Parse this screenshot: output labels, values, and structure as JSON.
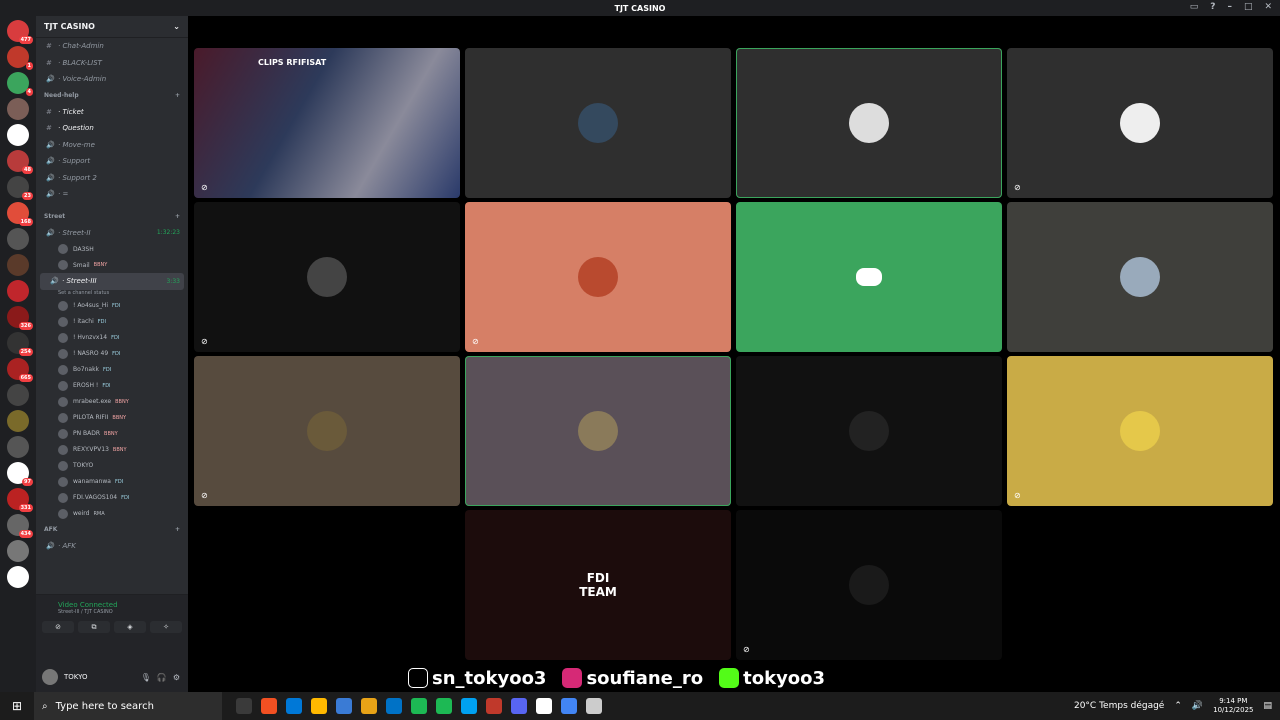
{
  "window": {
    "title": "TJT CASINO"
  },
  "guilds": [
    {
      "color": "#d83c3e",
      "badge": "477"
    },
    {
      "color": "#c0392b",
      "badge": "1"
    },
    {
      "color": "#3ba55d",
      "badge": "4"
    },
    {
      "color": "#7b5e57",
      "badge": ""
    },
    {
      "color": "#ffffff",
      "badge": ""
    },
    {
      "color": "#b83b3b",
      "badge": "48"
    },
    {
      "color": "#444",
      "badge": "23"
    },
    {
      "color": "#e14d3a",
      "badge": "168"
    },
    {
      "color": "#555",
      "badge": ""
    },
    {
      "color": "#5a3a2a",
      "badge": ""
    },
    {
      "color": "#c0262c",
      "badge": ""
    },
    {
      "color": "#8a1a1a",
      "badge": "326"
    },
    {
      "color": "#333",
      "badge": "254"
    },
    {
      "color": "#a22",
      "badge": "665"
    },
    {
      "color": "#444",
      "badge": ""
    },
    {
      "color": "#7a6a2a",
      "badge": ""
    },
    {
      "color": "#555",
      "badge": ""
    },
    {
      "color": "#fff",
      "badge": "97"
    },
    {
      "color": "#b22",
      "badge": "331"
    },
    {
      "color": "#666",
      "badge": "434"
    },
    {
      "color": "#777",
      "badge": ""
    },
    {
      "color": "#ffffff",
      "badge": ""
    }
  ],
  "sidebar": {
    "server_name": "TJT CASINO",
    "channels_top": [
      {
        "icon": "#",
        "label": "· Chat-Admin"
      },
      {
        "icon": "#",
        "label": "· BLACK-LIST"
      },
      {
        "icon": "🔊",
        "label": "· Voice-Admin"
      }
    ],
    "cat_help": "Need-help",
    "channels_help": [
      {
        "icon": "#",
        "label": "· Ticket",
        "active": true
      },
      {
        "icon": "#",
        "label": "· Question",
        "active": true
      },
      {
        "icon": "🔊",
        "label": "· Move-me"
      },
      {
        "icon": "🔊",
        "label": "· Support"
      },
      {
        "icon": "🔊",
        "label": "· Support 2"
      },
      {
        "icon": "🔊",
        "label": "· ="
      }
    ],
    "cat_street": "Street",
    "street2": {
      "label": "· Street-II",
      "time": "1:32:23"
    },
    "street2_users": [
      {
        "name": "DA3SH",
        "tag": ""
      },
      {
        "name": "Smail",
        "tag": "BBNY"
      }
    ],
    "street3": {
      "label": "· Street-III",
      "time": "3:33",
      "status": "Set a channel status"
    },
    "street3_users": [
      {
        "name": "! Ao4sus_Hi",
        "tag": "FDI"
      },
      {
        "name": "! itachi",
        "tag": "FDI"
      },
      {
        "name": "! Hvnzvx14",
        "tag": "FDI"
      },
      {
        "name": "! NASRO 49",
        "tag": "FDI"
      },
      {
        "name": "Bo7nakk",
        "tag": "FDI"
      },
      {
        "name": "EROSH !",
        "tag": "FDI"
      },
      {
        "name": "mrabeet.exe",
        "tag": "BBNY"
      },
      {
        "name": "PILOTA RIFII",
        "tag": "BBNY"
      },
      {
        "name": "PN BADR",
        "tag": "BBNY"
      },
      {
        "name": "REXY.VPV13",
        "tag": "BBNY"
      },
      {
        "name": "TOKYO",
        "tag": ""
      },
      {
        "name": "wanamanwa",
        "tag": "FDI"
      },
      {
        "name": "FDI.VAGOS104",
        "tag": "FDI"
      },
      {
        "name": "weird",
        "tag": "RMA"
      }
    ],
    "cat_afk": "AFK",
    "afk_channel": "· AFK"
  },
  "voice_panel": {
    "title": "Video Connected",
    "subtitle": "Street-III / TJT CASINO"
  },
  "user_panel": {
    "name": "TOKYO"
  },
  "stage": {
    "stream_label": "CLIPS RFIFISAT",
    "tiles": [
      {
        "bg": "#2a2a30",
        "avatar": "#5b6b8c",
        "mute": true,
        "stream": true
      },
      {
        "bg": "#2f2f2f",
        "avatar": "#34495e",
        "mute": false
      },
      {
        "bg": "#2f2f2f",
        "avatar": "#ddd",
        "mute": false,
        "speaking": true
      },
      {
        "bg": "#2f2f2f",
        "avatar": "#eee",
        "mute": true
      },
      {
        "bg": "#111111",
        "avatar": "#444",
        "mute": true
      },
      {
        "bg": "#d67f66",
        "avatar": "#b94a2f",
        "mute": true
      },
      {
        "bg": "#3ba55d",
        "avatar": "",
        "mute": false,
        "discord": true
      },
      {
        "bg": "#3f3f3b",
        "avatar": "#9ab",
        "mute": false
      },
      {
        "bg": "#574b3e",
        "avatar": "#6a5a3a",
        "mute": true
      },
      {
        "bg": "#5a5058",
        "avatar": "#8a7a5a",
        "mute": false,
        "speaking": true
      },
      {
        "bg": "#111111",
        "avatar": "#222",
        "mute": false
      },
      {
        "bg": "#c9ab46",
        "avatar": "#e5c84a",
        "mute": true
      },
      {
        "bg": "#000000",
        "avatar": "",
        "mute": false
      },
      {
        "bg": "#1c0c0c",
        "avatar": "#1c0c0c",
        "mute": false,
        "logo": "FDI TEAM"
      },
      {
        "bg": "#0a0a0a",
        "avatar": "#1a1a1a",
        "mute": true
      }
    ]
  },
  "overlay": {
    "tiktok": "sn_tokyoo3",
    "instagram": "soufiane_ro",
    "kick": "tokyoo3"
  },
  "taskbar": {
    "search_placeholder": "Type here to search",
    "weather": "20°C  Temps dégagé",
    "time": "9:14 PM",
    "date": "10/12/2025"
  }
}
